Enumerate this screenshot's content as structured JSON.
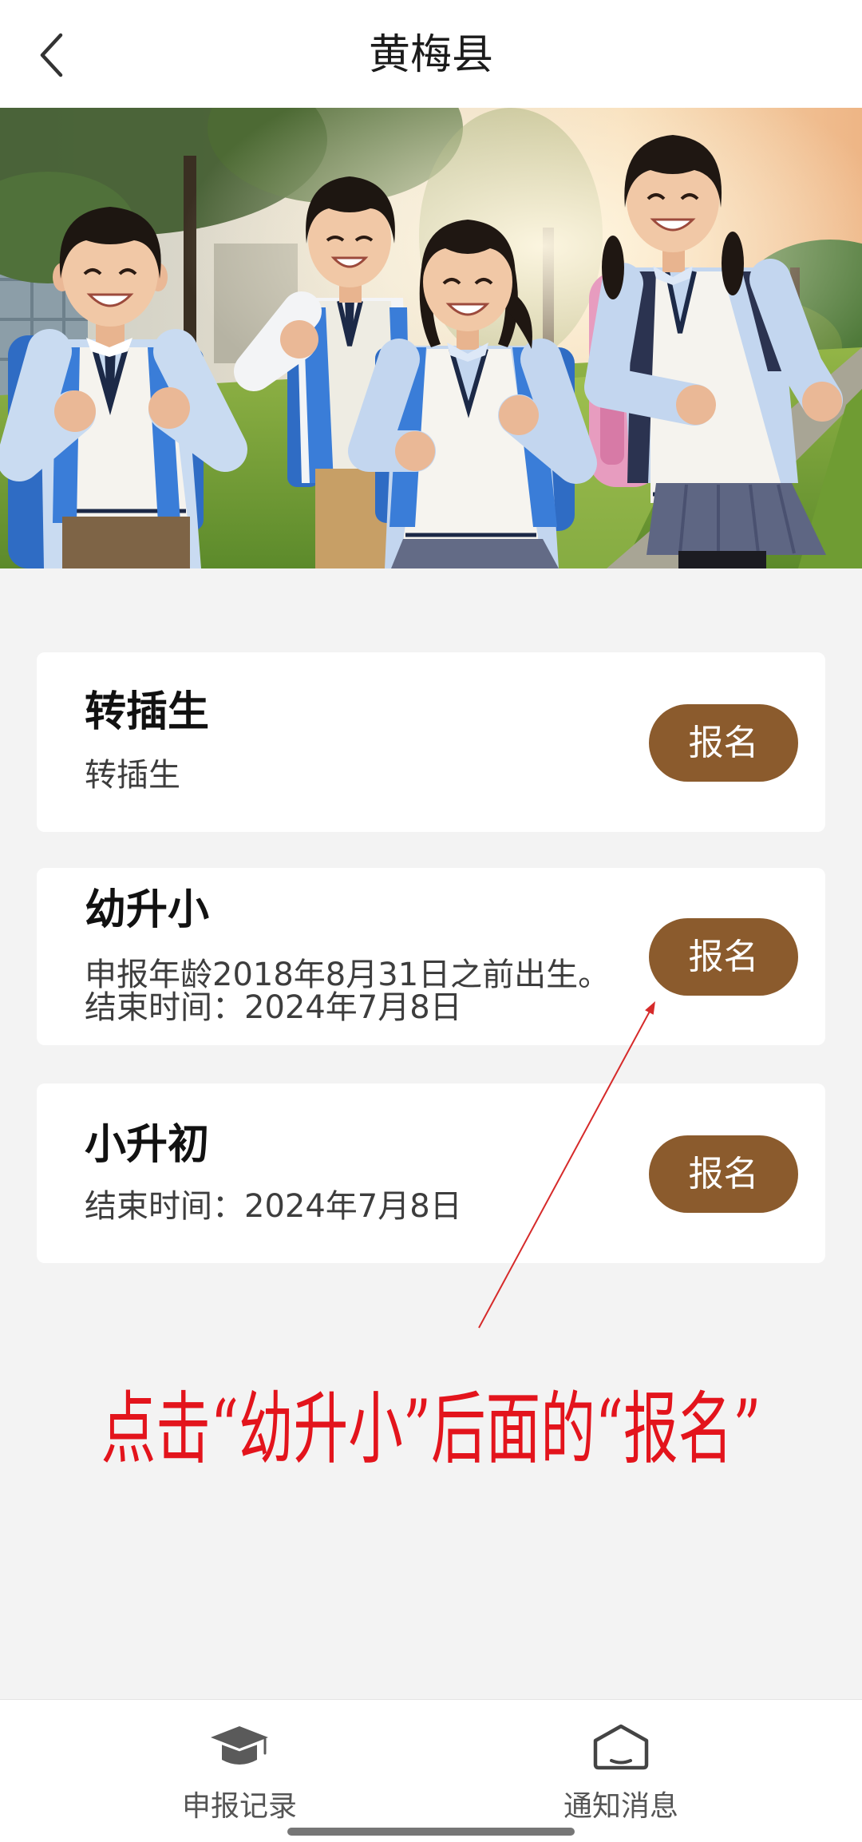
{
  "header": {
    "back_icon": "chevron-left-icon",
    "title": "黄梅县"
  },
  "cards": [
    {
      "title": "转插生",
      "lines": [
        "转插生"
      ],
      "button_label": "报名"
    },
    {
      "title": "幼升小",
      "lines": [
        "申报年龄2018年8月31日之前出生。",
        "结束时间：2024年7月8日"
      ],
      "button_label": "报名"
    },
    {
      "title": "小升初",
      "lines": [
        "结束时间：2024年7月8日"
      ],
      "button_label": "报名"
    }
  ],
  "annotation": {
    "text": "点击“幼升小”后面的“报名”"
  },
  "bottom_nav": {
    "items": [
      {
        "label": "申报记录",
        "icon": "graduation-cap-icon"
      },
      {
        "label": "通知消息",
        "icon": "mail-icon"
      }
    ]
  },
  "colors": {
    "accent": "#8b5b2d",
    "page_background": "#f3f3f3",
    "annotation": "#e3141c"
  }
}
